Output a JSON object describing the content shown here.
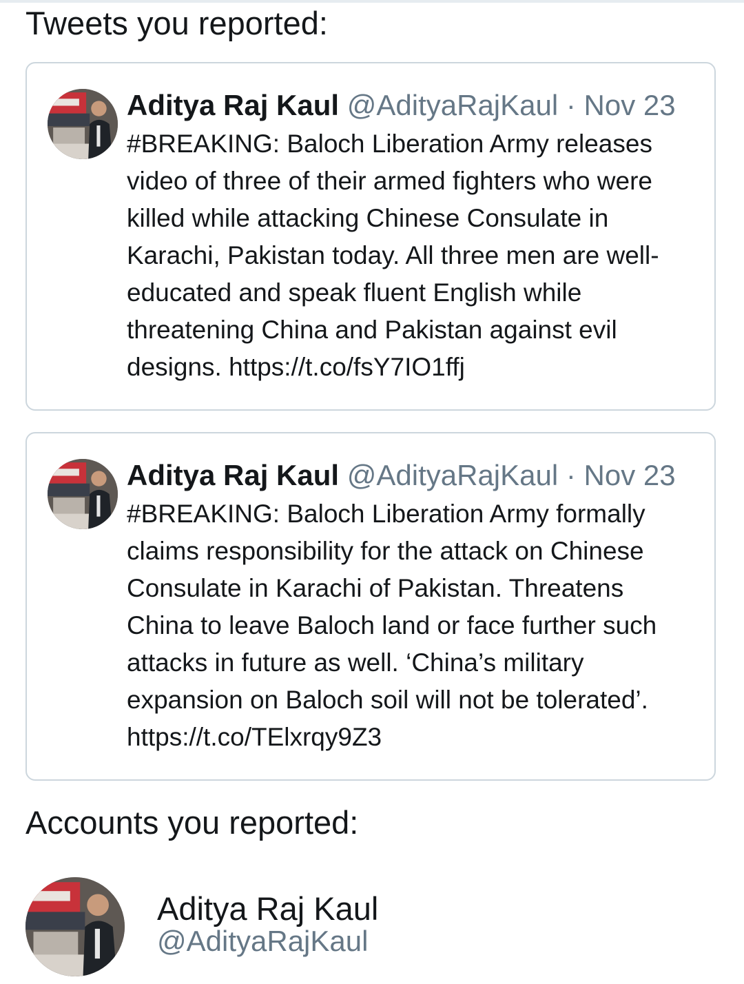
{
  "tweets_section": {
    "heading": "Tweets you reported:"
  },
  "tweets": [
    {
      "name": "Aditya Raj Kaul",
      "handle": "@AdityaRajKaul",
      "separator": "·",
      "date": "Nov 23",
      "text": "#BREAKING: Baloch Liberation Army releases\nvideo of three of their armed fighters who were\nkilled while attacking Chinese Consulate in\nKarachi, Pakistan today. All three men are well-\neducated and speak fluent English while\nthreatening China and Pakistan against evil\ndesigns. https://t.co/fsY7IO1ffj",
      "avatar_icon": "profile-photo"
    },
    {
      "name": "Aditya Raj Kaul",
      "handle": "@AdityaRajKaul",
      "separator": "·",
      "date": "Nov 23",
      "text": "#BREAKING: Baloch Liberation Army formally\nclaims responsibility for the attack on Chinese\nConsulate in Karachi of Pakistan. Threatens\nChina to leave Baloch land or face further such\nattacks in future as well. ‘China’s military\nexpansion on Baloch soil will not be tolerated’.\nhttps://t.co/TElxrqy9Z3",
      "avatar_icon": "profile-photo"
    }
  ],
  "accounts_section": {
    "heading": "Accounts you reported:"
  },
  "accounts": [
    {
      "name": "Aditya Raj Kaul",
      "handle": "@AdityaRajKaul",
      "avatar_icon": "profile-photo"
    }
  ],
  "colors": {
    "text_primary": "#14171a",
    "text_secondary": "#657786",
    "card_border": "#ccd6dd"
  }
}
